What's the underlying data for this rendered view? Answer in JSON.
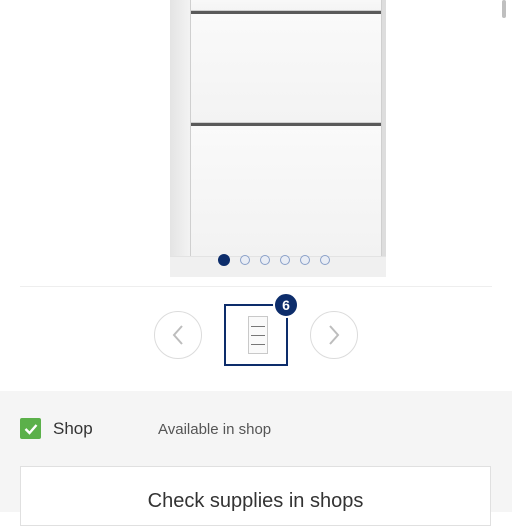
{
  "product_gallery": {
    "image_alt": "White shoe cabinet with drawers",
    "active_slide": 1,
    "slide_count": 6,
    "thumbnail_count_badge": "6"
  },
  "availability": {
    "shop_label": "Shop",
    "shop_status": "Available in shop",
    "check_supplies_label": "Check supplies in shops"
  },
  "colors": {
    "accent": "#0d2d6b",
    "check_green": "#5bb04a",
    "panel_bg": "#f5f5f5"
  },
  "icons": {
    "prev": "chevron-left-icon",
    "next": "chevron-right-icon",
    "check": "checkmark-icon"
  }
}
